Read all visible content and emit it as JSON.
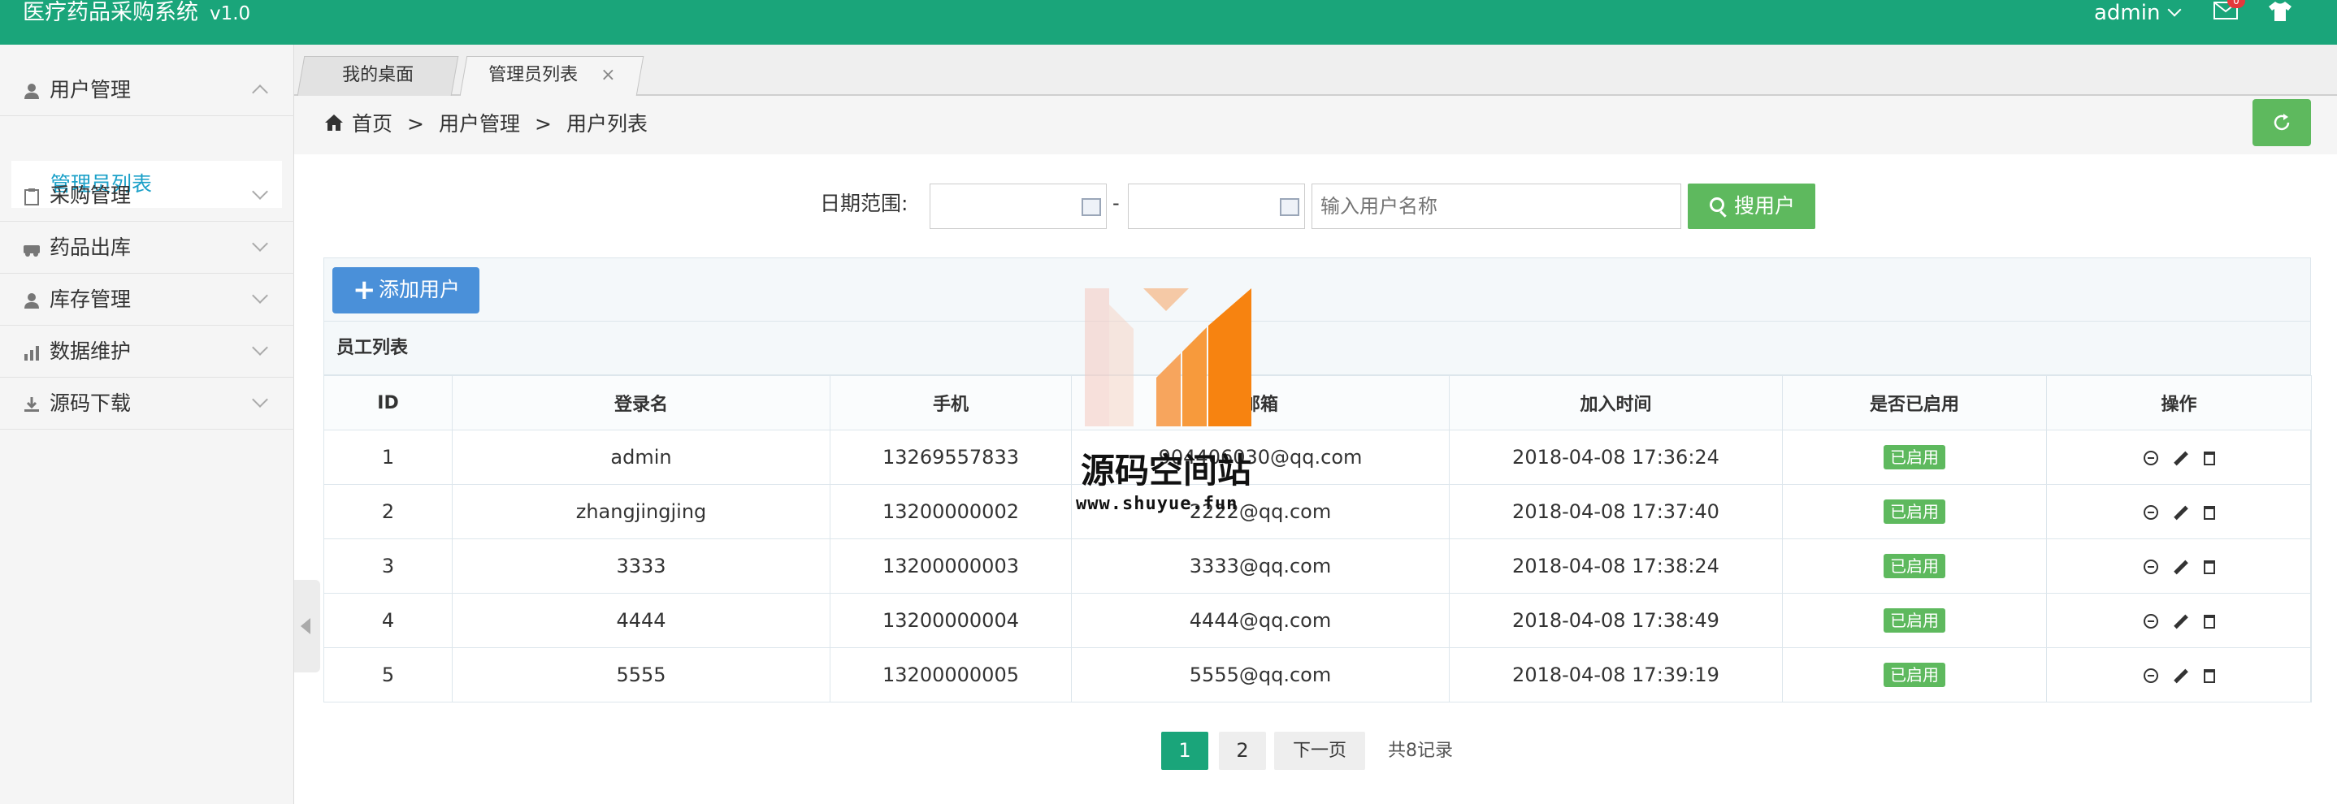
{
  "header": {
    "title": "医疗药品采购系统",
    "version": "v1.0",
    "user": "admin",
    "mail_count": "0",
    "colors": {
      "bar": "#1aa57a"
    }
  },
  "sidebar": {
    "groups": [
      {
        "label": "用户管理",
        "icon": "user-icon",
        "expanded": true
      },
      {
        "label": "采购管理",
        "icon": "clipboard-icon",
        "expanded": false
      },
      {
        "label": "药品出库",
        "icon": "truck-icon",
        "expanded": false
      },
      {
        "label": "库存管理",
        "icon": "user-icon",
        "expanded": false
      },
      {
        "label": "数据维护",
        "icon": "bar-chart-icon",
        "expanded": false
      },
      {
        "label": "源码下载",
        "icon": "download-icon",
        "expanded": false
      }
    ],
    "active_sub": "管理员列表"
  },
  "tabs": [
    {
      "label": "我的桌面"
    },
    {
      "label": "管理员列表",
      "closable": true,
      "close_glyph": "×"
    }
  ],
  "breadcrumb": {
    "items": [
      "首页",
      "用户管理",
      "用户列表"
    ],
    "separator": ">"
  },
  "search": {
    "label": "日期范围:",
    "dash": "-",
    "name_placeholder": "输入用户名称",
    "button_label": "搜用户"
  },
  "toolbar": {
    "add_label": "添加用户"
  },
  "table": {
    "title": "员工列表",
    "columns": [
      "ID",
      "登录名",
      "手机",
      "邮箱",
      "加入时间",
      "是否已启用",
      "操作"
    ],
    "rows": [
      {
        "id": "1",
        "login": "admin",
        "phone": "13269557833",
        "email": "904406030@qq.com",
        "joined": "2018-04-08 17:36:24",
        "status": "已启用"
      },
      {
        "id": "2",
        "login": "zhangjingjing",
        "phone": "13200000002",
        "email": "2222@qq.com",
        "joined": "2018-04-08 17:37:40",
        "status": "已启用"
      },
      {
        "id": "3",
        "login": "3333",
        "phone": "13200000003",
        "email": "3333@qq.com",
        "joined": "2018-04-08 17:38:24",
        "status": "已启用"
      },
      {
        "id": "4",
        "login": "4444",
        "phone": "13200000004",
        "email": "4444@qq.com",
        "joined": "2018-04-08 17:38:49",
        "status": "已启用"
      },
      {
        "id": "5",
        "login": "5555",
        "phone": "13200000005",
        "email": "5555@qq.com",
        "joined": "2018-04-08 17:39:19",
        "status": "已启用"
      }
    ]
  },
  "pagination": {
    "current": "1",
    "page2": "2",
    "next": "下一页",
    "total": "共8记录"
  },
  "watermark": {
    "text": "源码空间站",
    "url": "www.shuyue.fun"
  }
}
